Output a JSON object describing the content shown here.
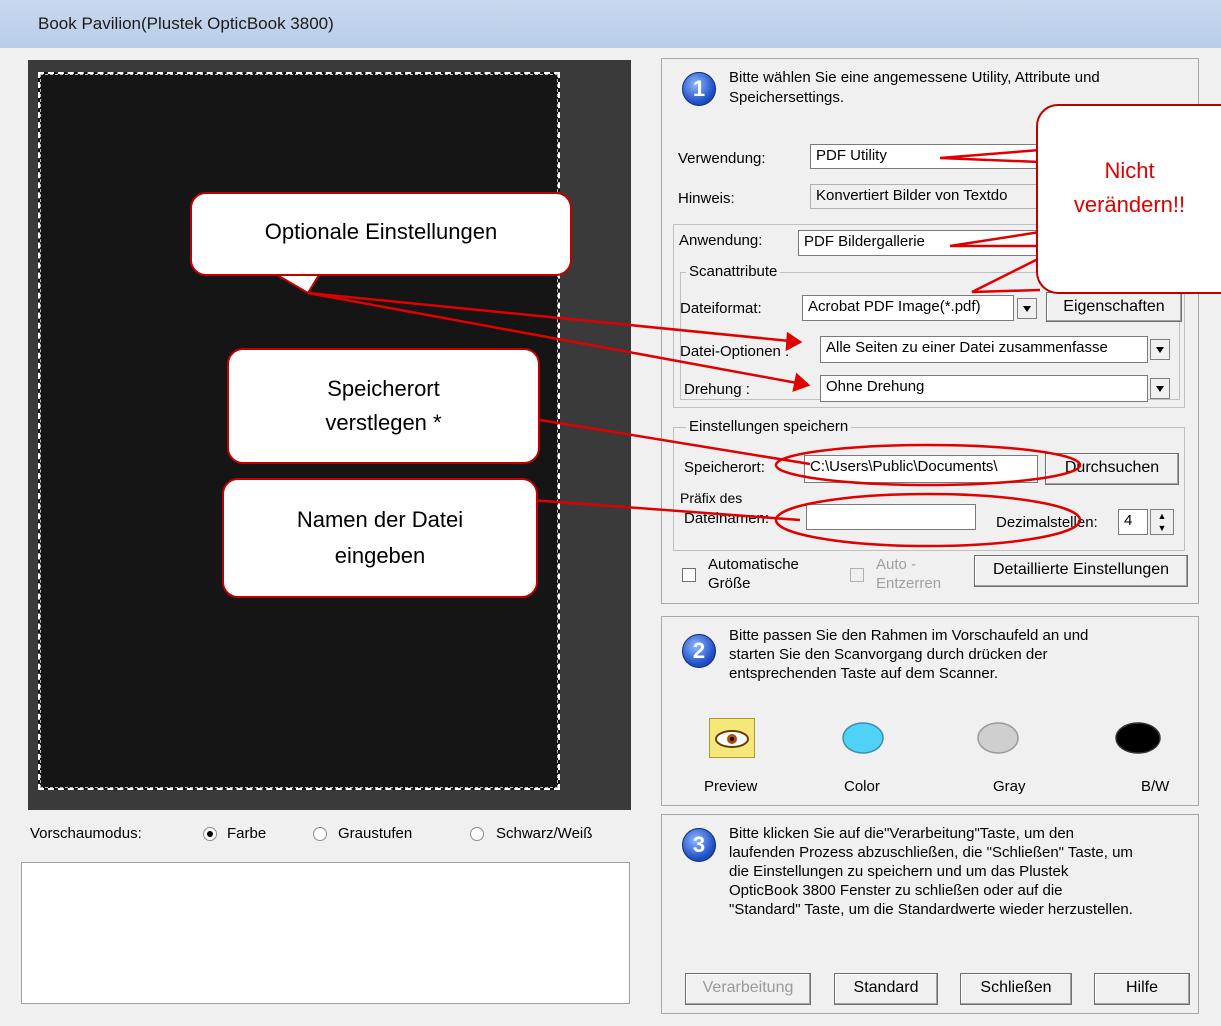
{
  "window": {
    "title": "Book Pavilion(Plustek OpticBook 3800)"
  },
  "preview_mode": {
    "label": "Vorschaumodus:",
    "options": [
      {
        "label": "Farbe",
        "selected": true
      },
      {
        "label": "Graustufen",
        "selected": false
      },
      {
        "label": "Schwarz/Weiß",
        "selected": false
      }
    ]
  },
  "step1": {
    "number": "1",
    "instruction": "Bitte wählen Sie eine angemessene Utility, Attribute und Speichersettings.",
    "verwendung_label": "Verwendung:",
    "verwendung_value": "PDF Utility",
    "hinweis_label": "Hinweis:",
    "hinweis_value": "Konvertiert Bilder von Textdo",
    "anwendung_label": "Anwendung:",
    "anwendung_value": "PDF Bildergallerie",
    "scanattribute": {
      "legend": "Scanattribute",
      "dateiformat_label": "Dateiformat:",
      "dateiformat_value": "Acrobat PDF Image(*.pdf)",
      "eigenschaften_button": "Eigenschaften",
      "dateioptionen_label": "Datei-Optionen :",
      "dateioptionen_value": "Alle Seiten zu einer Datei zusammenfasse",
      "drehung_label": "Drehung :",
      "drehung_value": "Ohne Drehung"
    },
    "einstellungen": {
      "legend": "Einstellungen speichern",
      "speicherort_label": "Speicherort:",
      "speicherort_value": "C:\\Users\\Public\\Documents\\",
      "durchsuchen_button": "Durchsuchen",
      "praefix_label_1": "Präfix des",
      "praefix_label_2": "Dateinamen:",
      "praefix_value": "",
      "dezimal_label": "Dezimalstellen:",
      "dezimal_value": "4"
    },
    "auto_groesse_1": "Automatische",
    "auto_groesse_2": "Größe",
    "auto_entzerren_1": "Auto -",
    "auto_entzerren_2": "Entzerren",
    "detail_button": "Detaillierte Einstellungen"
  },
  "step2": {
    "number": "2",
    "instruction_1": "Bitte passen Sie den Rahmen im Vorschaufeld an und",
    "instruction_2": "starten Sie den Scanvorgang durch drücken der",
    "instruction_3": "entsprechenden Taste auf dem Scanner.",
    "buttons": [
      {
        "label": "Preview",
        "icon": "eye-icon"
      },
      {
        "label": "Color",
        "icon": "color-oval-icon",
        "color": "#4fd2f5"
      },
      {
        "label": "Gray",
        "icon": "gray-oval-icon",
        "color": "#cfcfcf"
      },
      {
        "label": "B/W",
        "icon": "bw-oval-icon",
        "color": "#000000"
      }
    ]
  },
  "step3": {
    "number": "3",
    "instruction_1": "Bitte klicken Sie auf die\"Verarbeitung\"Taste, um den",
    "instruction_2": "laufenden Prozess abzuschließen, die \"Schließen\" Taste, um",
    "instruction_3": "die Einstellungen zu speichern und um das Plustek",
    "instruction_4": "OpticBook 3800 Fenster zu schließen oder auf die",
    "instruction_5": "\"Standard\" Taste, um die Standardwerte wieder herzustellen.",
    "buttons": {
      "verarbeitung": "Verarbeitung",
      "standard": "Standard",
      "schliessen": "Schließen",
      "hilfe": "Hilfe"
    }
  },
  "annotations": {
    "optionale": "Optionale Einstellungen",
    "speicherort_1": "Speicherort",
    "speicherort_2": "verstlegen *",
    "namen_1": "Namen der Datei",
    "namen_2": "eingeben",
    "nicht_1": "Nicht",
    "nicht_2": "verändern!!"
  },
  "colors": {
    "annotation_red": "#e00000",
    "title_bar": "#c8d9ee"
  }
}
